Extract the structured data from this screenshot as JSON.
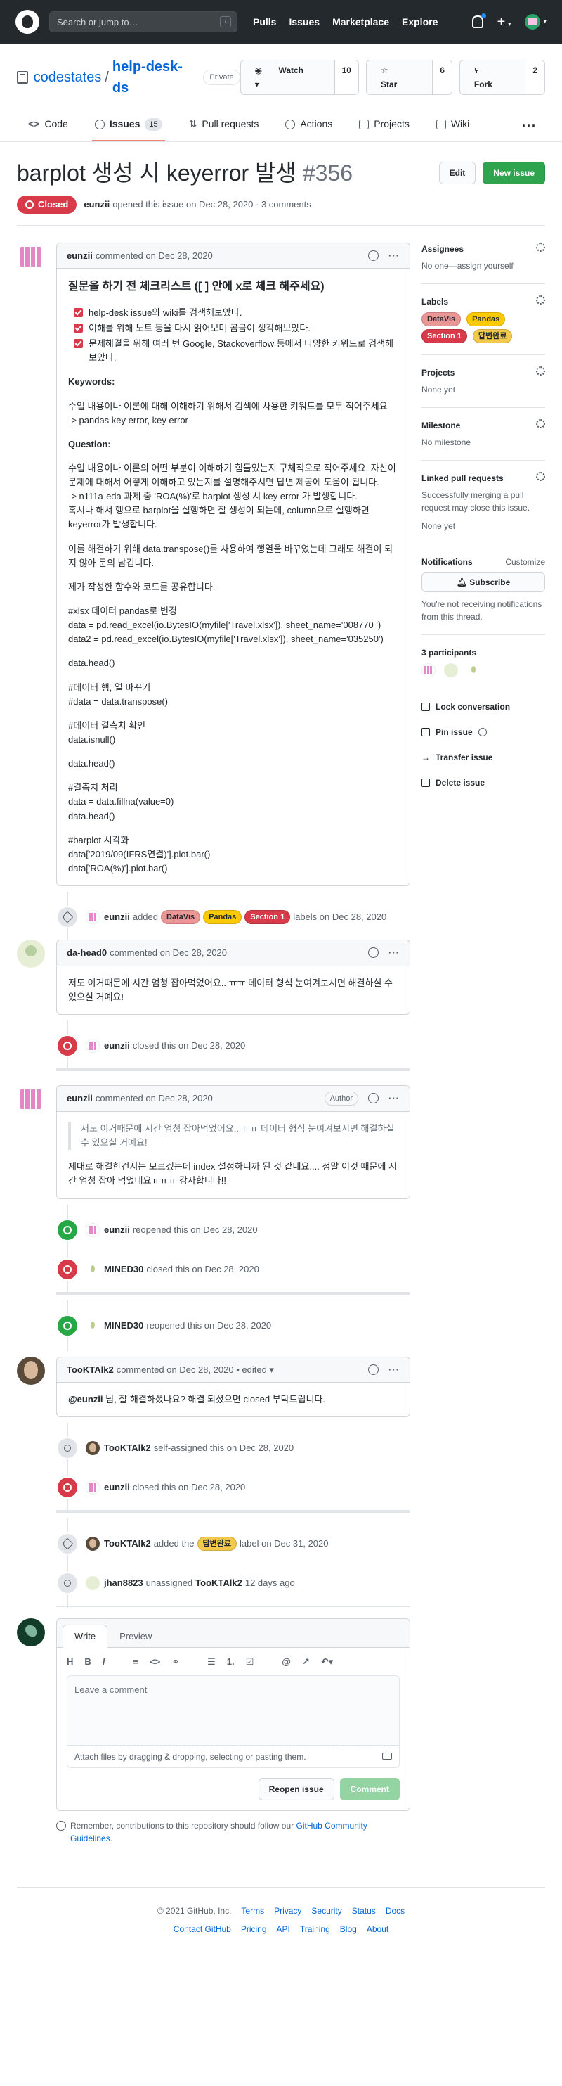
{
  "topbar": {
    "search_placeholder": "Search or jump to…",
    "slash_key": "/",
    "nav": [
      "Pulls",
      "Issues",
      "Marketplace",
      "Explore"
    ],
    "plus": "+",
    "caret": "▾"
  },
  "repo": {
    "owner": "codestates",
    "sep": "/",
    "name": "help-desk-ds",
    "visibility": "Private",
    "watch_label": "Watch",
    "watch_count": "10",
    "star_label": "Star",
    "star_count": "6",
    "fork_label": "Fork",
    "fork_count": "2",
    "tabs": [
      {
        "label": "Code"
      },
      {
        "label": "Issues",
        "count": "15"
      },
      {
        "label": "Pull requests"
      },
      {
        "label": "Actions"
      },
      {
        "label": "Projects"
      },
      {
        "label": "Wiki"
      }
    ],
    "more": "···"
  },
  "issue": {
    "title": "barplot 생성 시 keyerror 발생",
    "number": "#356",
    "edit_label": "Edit",
    "new_label": "New issue",
    "state": "Closed",
    "author": "eunzii",
    "opened_text": "opened this issue on Dec 28, 2020 · 3 comments"
  },
  "first_comment": {
    "author": "eunzii",
    "meta": "commented on Dec 28, 2020",
    "heading": "질문을 하기 전 체크리스트 ([ ] 안에 x로 체크 해주세요)",
    "checklist": [
      "help-desk issue와 wiki를 검색해보았다.",
      "이해를 위해 노트 등을 다시 읽어보며 곰곰이 생각해보았다.",
      "문제해결을 위해 여러 번 Google, Stackoverflow 등에서 다양한 키워드로 검색해 보았다."
    ],
    "keywords_h": "Keywords:",
    "keywords_desc": "수업 내용이나 이론에 대해 이해하기 위해서 검색에 사용한 키워드를 모두 적어주세요",
    "keywords_val": "-> pandas key error, key error",
    "question_h": "Question:",
    "question_p1": "수업 내용이나 이론의 어떤 부분이 이해하기 힘들었는지 구체적으로 적어주세요. 자신이 문제에 대해서 어떻게 이해하고 있는지를 설명해주시면 답변 제공에 도움이 됩니다.",
    "question_p2": "-> n111a-eda 과제 중 'ROA(%)'로 barplot 생성 시 key error 가 발생합니다.",
    "question_p3": "혹시나 해서 행으로 barplot을 실행하면 잘 생성이 되는데, column으로 실행하면 keyerror가 발생합니다.",
    "para2": "이를 해결하기 위해 data.transpose()를 사용하여 행열을 바꾸었는데 그래도 해결이 되지 않아 문의 남깁니다.",
    "para3": "제가 작성한 함수와 코드를 공유합니다.",
    "code1": [
      "#xlsx 데이터 pandas로 변경",
      "data = pd.read_excel(io.BytesIO(myfile['Travel.xlsx']), sheet_name='008770 ')",
      "data2 = pd.read_excel(io.BytesIO(myfile['Travel.xlsx']), sheet_name='035250')"
    ],
    "code2": [
      "data.head()"
    ],
    "code3": [
      "#데이터 행, 열 바꾸기",
      "#data = data.transpose()"
    ],
    "code4": [
      "#데이터 결측치 확인",
      "data.isnull()"
    ],
    "code5": [
      "data.head()"
    ],
    "code6": [
      "#결측치 처리",
      "data = data.fillna(value=0)",
      "data.head()"
    ],
    "code7": [
      "#barplot 시각화",
      "data['2019/09(IFRS연결)'].plot.bar()",
      "data['ROA(%)'].plot.bar()"
    ]
  },
  "events": {
    "e1_user": "eunzii",
    "e1_verb": "added",
    "e1_labels": [
      "DataVis",
      "Pandas",
      "Section 1"
    ],
    "e1_tail": "labels on Dec 28, 2020",
    "c2_author": "da-head0",
    "c2_meta": "commented on Dec 28, 2020",
    "c2_body": "저도 이거때문에 시간 엄청 잡아먹었어요.. ㅠㅠ 데이터 형식 눈여겨보시면 해결하실 수 있으실 거예요!",
    "e2_user": "eunzii",
    "e2_text": "closed this on Dec 28, 2020",
    "c3_author": "eunzii",
    "c3_meta": "commented on Dec 28, 2020",
    "c3_badge": "Author",
    "c3_quote": "저도 이거때문에 시간 엄청 잡아먹었어요.. ㅠㅠ 데이터 형식 눈여겨보시면 해결하실 수 있으실 거예요!",
    "c3_body": "제대로 해결한건지는 모르겠는데 index 설정하니까 된 것 같네요.... 정말 이것 때문에 시간 엄청 잡아 먹었네요ㅠㅠㅠ 감사합니다!!",
    "e3_user": "eunzii",
    "e3_text": "reopened this on Dec 28, 2020",
    "e4_user": "MINED30",
    "e4_text": "closed this on Dec 28, 2020",
    "e5_user": "MINED30",
    "e5_text": "reopened this on Dec 28, 2020",
    "c4_author": "TooKTAlk2",
    "c4_meta": "commented on Dec 28, 2020 • edited ▾",
    "c4_mention": "@eunzii",
    "c4_body": " 님, 잘 해결하셨나요? 해결 되셨으면 closed 부탁드립니다.",
    "e6_user": "TooKTAlk2",
    "e6_text": "self-assigned this on Dec 28, 2020",
    "e7_user": "eunzii",
    "e7_text": "closed this on Dec 28, 2020",
    "e8_user": "TooKTAlk2",
    "e8_verb": "added the",
    "e8_label": "답변완료",
    "e8_tail": "label on Dec 31, 2020",
    "e9_user": "jhan8823",
    "e9_verb": "unassigned",
    "e9_target": "TooKTAlk2",
    "e9_tail": "12 days ago"
  },
  "editor": {
    "tab_write": "Write",
    "tab_preview": "Preview",
    "tools": [
      "H",
      "B",
      "I",
      "≡",
      "<>",
      "⚭",
      "☰",
      "1.",
      "☑",
      "@",
      "↗",
      "↶▾"
    ],
    "placeholder": "Leave a comment",
    "attach": "Attach files by dragging & dropping, selecting or pasting them.",
    "reopen": "Reopen issue",
    "comment": "Comment",
    "note": "Remember, contributions to this repository should follow our",
    "note_link": "GitHub Community Guidelines",
    "note_end": "."
  },
  "sidebar": {
    "assignees_h": "Assignees",
    "assignees_v": "No one—assign yourself",
    "labels_h": "Labels",
    "labels": [
      "DataVis",
      "Pandas",
      "Section 1",
      "답변완료"
    ],
    "projects_h": "Projects",
    "projects_v": "None yet",
    "milestone_h": "Milestone",
    "milestone_v": "No milestone",
    "linked_h": "Linked pull requests",
    "linked_desc": "Successfully merging a pull request may close this issue.",
    "linked_v": "None yet",
    "notif_h": "Notifications",
    "notif_customize": "Customize",
    "subscribe": "Subscribe",
    "notif_desc": "You're not receiving notifications from this thread.",
    "participants_h": "3 participants",
    "lock": "Lock conversation",
    "pin": "Pin issue",
    "transfer": "Transfer issue",
    "delete": "Delete issue"
  },
  "footer": {
    "copy": "© 2021 GitHub, Inc.",
    "row1": [
      "Terms",
      "Privacy",
      "Security",
      "Status",
      "Docs"
    ],
    "row2": [
      "Contact GitHub",
      "Pricing",
      "API",
      "Training",
      "Blog",
      "About"
    ]
  }
}
